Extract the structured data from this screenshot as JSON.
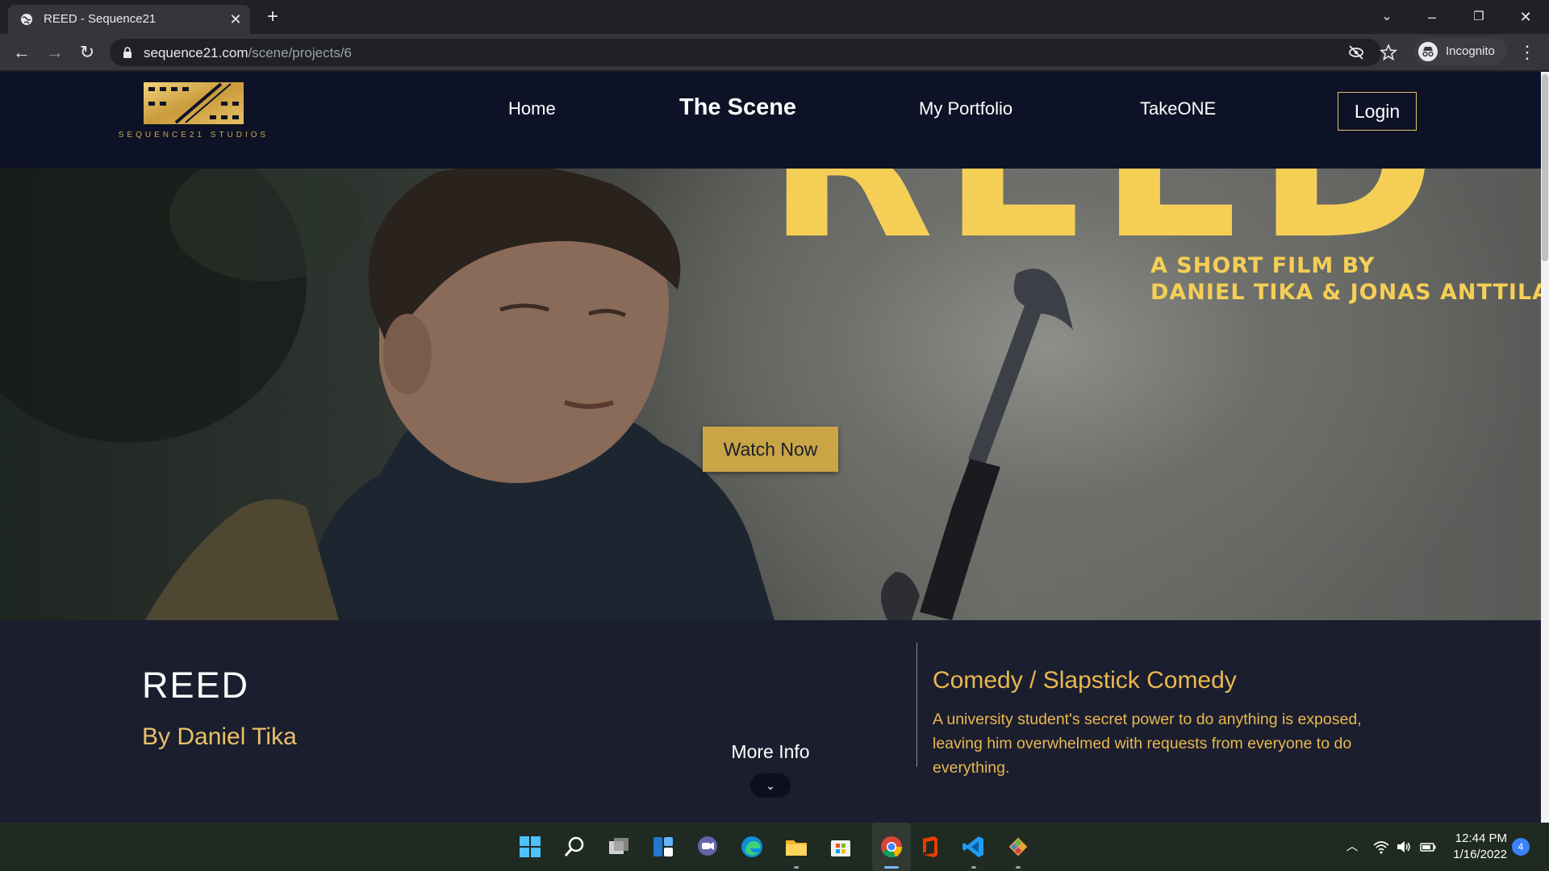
{
  "browser": {
    "tab_title": "REED - Sequence21",
    "tab_close": "✕",
    "new_tab": "+",
    "url_domain": "sequence21.com",
    "url_path": "/scene/projects/6",
    "profile_label": "Incognito"
  },
  "site": {
    "logo_text": "SEQUENCE21 STUDIOS",
    "nav": {
      "home": "Home",
      "scene": "The Scene",
      "portfolio": "My Portfolio",
      "takeone": "TakeONE",
      "login": "Login"
    }
  },
  "hero": {
    "poster_title": "REED",
    "poster_sub_line1": "A SHORT FILM BY",
    "poster_sub_line2": "DANIEL TIKA & JONAS ANTTILA",
    "watch_label": "Watch Now"
  },
  "info": {
    "title": "REED",
    "author": "By Daniel Tika",
    "more_info": "More Info",
    "more_chevron": "⌄",
    "genre": "Comedy / Slapstick Comedy",
    "synopsis": "A university student's secret power to do anything is exposed, leaving him overwhelmed with requests from everyone to do everything."
  },
  "taskbar": {
    "time": "12:44 PM",
    "date": "1/16/2022",
    "notifications": "4"
  },
  "colors": {
    "header_bg": "#0e1226",
    "accent_gold": "#e9b84f",
    "poster_yellow": "#f5cf55",
    "info_bg": "#1b1e2e"
  }
}
